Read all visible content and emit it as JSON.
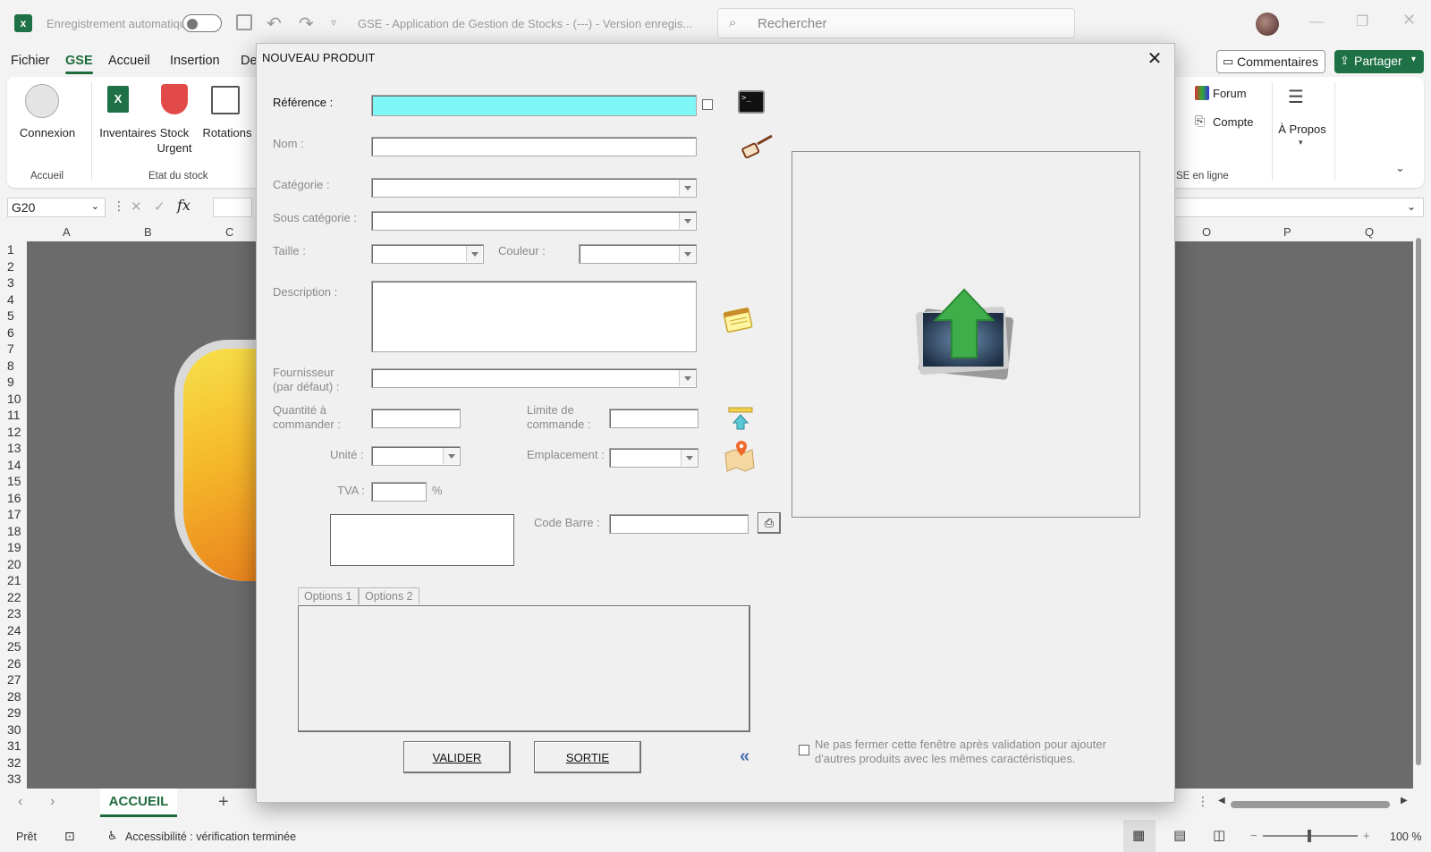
{
  "titlebar": {
    "autosave_label": "Enregistrement automatique",
    "window_title": "GSE - Application de Gestion de Stocks - (---) - Version enregis...",
    "search_placeholder": "Rechercher"
  },
  "menu": {
    "tabs": [
      "Fichier",
      "GSE",
      "Accueil",
      "Insertion",
      "De"
    ],
    "active_tab": "GSE",
    "comments_button": "Commentaires",
    "share_button": "Partager"
  },
  "ribbon": {
    "connexion": "Connexion",
    "inventaires": "Inventaires",
    "stock_urgent_1": "Stock",
    "stock_urgent_2": "Urgent",
    "rotations": "Rotations",
    "group_accueil": "Accueil",
    "group_etat": "Etat du stock",
    "forum": "Forum",
    "compte": "Compte",
    "apropos": "À Propos",
    "group_gse_en_ligne": "SE en ligne"
  },
  "formula": {
    "name_box": "G20",
    "fx_label": "fx"
  },
  "grid": {
    "columns_left": [
      "A",
      "B",
      "C"
    ],
    "columns_right": [
      "O",
      "P",
      "Q"
    ],
    "rows": [
      "1",
      "2",
      "3",
      "4",
      "5",
      "6",
      "7",
      "8",
      "9",
      "10",
      "11",
      "12",
      "13",
      "14",
      "15",
      "16",
      "17",
      "18",
      "19",
      "20",
      "21",
      "22",
      "23",
      "24",
      "25",
      "26",
      "27",
      "28",
      "29",
      "30",
      "31",
      "32",
      "33"
    ]
  },
  "sheets": {
    "active": "ACCUEIL"
  },
  "statusbar": {
    "ready": "Prêt",
    "accessibility": "Accessibilité : vérification terminée",
    "zoom": "100 %"
  },
  "dialog": {
    "title": "NOUVEAU PRODUIT",
    "reference_label": "Référence :",
    "nom_label": "Nom :",
    "categorie_label": "Catégorie :",
    "sous_categorie_label": "Sous catégorie :",
    "taille_label": "Taille :",
    "couleur_label": "Couleur :",
    "description_label": "Description :",
    "fournisseur_label_1": "Fournisseur",
    "fournisseur_label_2": "(par défaut) :",
    "quantite_label_1": "Quantité à",
    "quantite_label_2": "commander :",
    "limite_label_1": "Limite de",
    "limite_label_2": "commande :",
    "unite_label": "Unité :",
    "emplacement_label": "Emplacement :",
    "tva_label": "TVA :",
    "tva_unit": "%",
    "code_barre_label": "Code Barre :",
    "options_tabs": [
      "Options 1",
      "Options 2"
    ],
    "valider_button": "VALIDER",
    "sortie_button": "SORTIE",
    "collapse_glyph": "«",
    "keep_open_text_1": "Ne pas fermer cette fenêtre après validation pour ajouter",
    "keep_open_text_2": "d'autres produits avec les mêmes caractéristiques.",
    "reference_color": "#80f7f7"
  }
}
